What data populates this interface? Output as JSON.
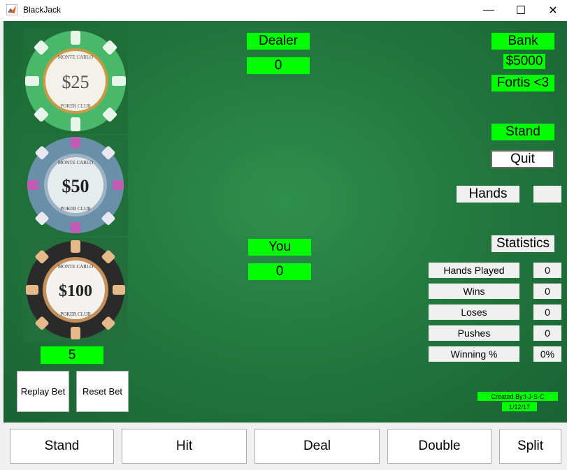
{
  "window": {
    "title": "BlackJack",
    "minimize_glyph": "—",
    "maximize_glyph": "☐",
    "close_glyph": "✕"
  },
  "chips": [
    {
      "label": "$25",
      "brand_top": "MONTE CARLO",
      "brand_bottom": "POKER CLUB",
      "color": "#4ab86a"
    },
    {
      "label": "$50",
      "brand_top": "MONTE CARLO",
      "brand_bottom": "POKER CLUB",
      "color": "#6a8fa8"
    },
    {
      "label": "$100",
      "brand_top": "MONTE CARLO",
      "brand_bottom": "POKER CLUB",
      "color": "#2a2a2a"
    }
  ],
  "bet": {
    "value": "5"
  },
  "bet_buttons": {
    "replay": "Replay Bet",
    "reset": "Reset Bet"
  },
  "dealer": {
    "label": "Dealer",
    "score": "0"
  },
  "player": {
    "label": "You",
    "score": "0"
  },
  "bank": {
    "label": "Bank",
    "amount": "$5000",
    "player_name": "Fortis <3"
  },
  "side_controls": {
    "stand": "Stand",
    "quit": "Quit",
    "hands_label": "Hands",
    "hands_value": ""
  },
  "statistics": {
    "title": "Statistics",
    "rows": [
      {
        "label": "Hands Played",
        "value": "0"
      },
      {
        "label": "Wins",
        "value": "0"
      },
      {
        "label": "Loses",
        "value": "0"
      },
      {
        "label": "Pushes",
        "value": "0"
      },
      {
        "label": "Winning %",
        "value": "0%"
      }
    ]
  },
  "credits": {
    "author": "Created By:I-J-S-C",
    "date": "1/12/17"
  },
  "actions": {
    "stand": "Stand",
    "hit": "Hit",
    "deal": "Deal",
    "double": "Double",
    "split": "Split"
  },
  "colors": {
    "felt": "#237a3f",
    "label_green": "#00ff00",
    "panel_gray": "#f0f0f0"
  }
}
